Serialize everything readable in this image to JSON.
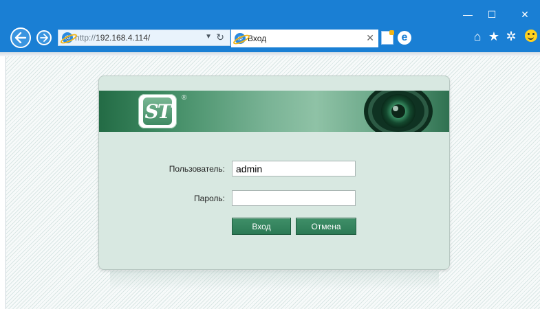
{
  "browser": {
    "address_scheme": "http://",
    "address_host": "192.168.4.114/",
    "tab_title": "Вход",
    "chrome_color": "#1a7fd4",
    "window_controls": {
      "minimize": "—",
      "maximize": "☐",
      "close": "✕"
    },
    "tab_close": "✕",
    "icons": {
      "back": "back-arrow-icon",
      "forward": "forward-arrow-icon",
      "home": "⌂",
      "favorites": "★",
      "settings": "✲",
      "feedback": "smiley-icon"
    }
  },
  "login": {
    "logo_text": "ST",
    "registered_mark": "®",
    "username_label": "Пользователь:",
    "username_value": "admin",
    "password_label": "Пароль:",
    "password_value": "",
    "login_button": "Вход",
    "cancel_button": "Отмена",
    "accent_color": "#2e7d57"
  }
}
